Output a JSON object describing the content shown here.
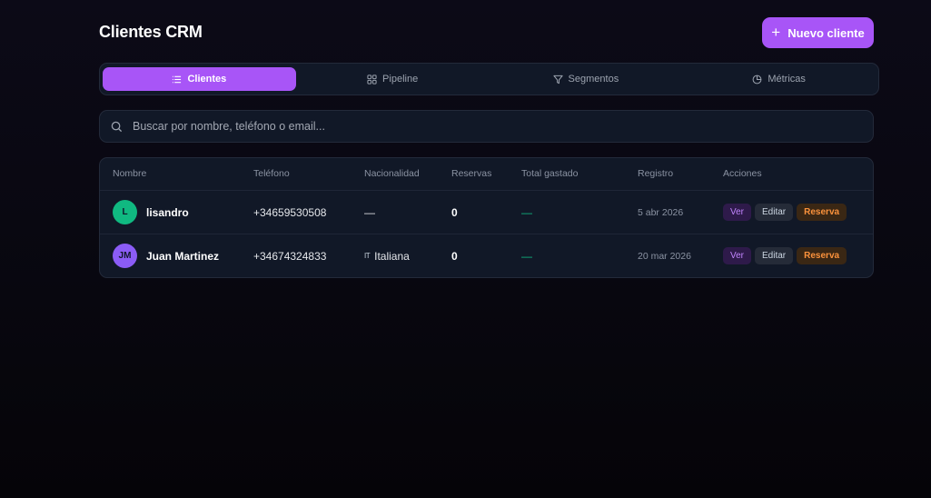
{
  "header": {
    "title": "Clientes CRM",
    "new_button": "Nuevo cliente"
  },
  "tabs": [
    {
      "label": "Clientes",
      "icon": "list-icon",
      "active": true
    },
    {
      "label": "Pipeline",
      "icon": "grid-icon",
      "active": false
    },
    {
      "label": "Segmentos",
      "icon": "filter-icon",
      "active": false
    },
    {
      "label": "Métricas",
      "icon": "pie-chart-icon",
      "active": false
    }
  ],
  "search": {
    "placeholder": "Buscar por nombre, teléfono o email...",
    "value": ""
  },
  "table": {
    "columns": [
      "Nombre",
      "Teléfono",
      "Nacionalidad",
      "Reservas",
      "Total gastado",
      "Registro",
      "Acciones"
    ],
    "rows": [
      {
        "initials": "L",
        "avatar_color": "#10b981",
        "name": "lisandro",
        "phone": "+34659530508",
        "flag": "",
        "nationality": "—",
        "reservas": "0",
        "total": "—",
        "registro": "5 abr 2026"
      },
      {
        "initials": "JM",
        "avatar_color": "#8b5cf6",
        "name": "Juan Martinez",
        "phone": "+34674324833",
        "flag": "IT",
        "nationality": "Italiana",
        "reservas": "0",
        "total": "—",
        "registro": "20 mar 2026"
      }
    ],
    "actions": {
      "view": "Ver",
      "edit": "Editar",
      "reserve": "Reserva"
    }
  },
  "colors": {
    "accent": "#a855f7",
    "background": "#0a0912",
    "panel": "#111827",
    "teal": "#10b981",
    "orange": "#fb923c"
  }
}
